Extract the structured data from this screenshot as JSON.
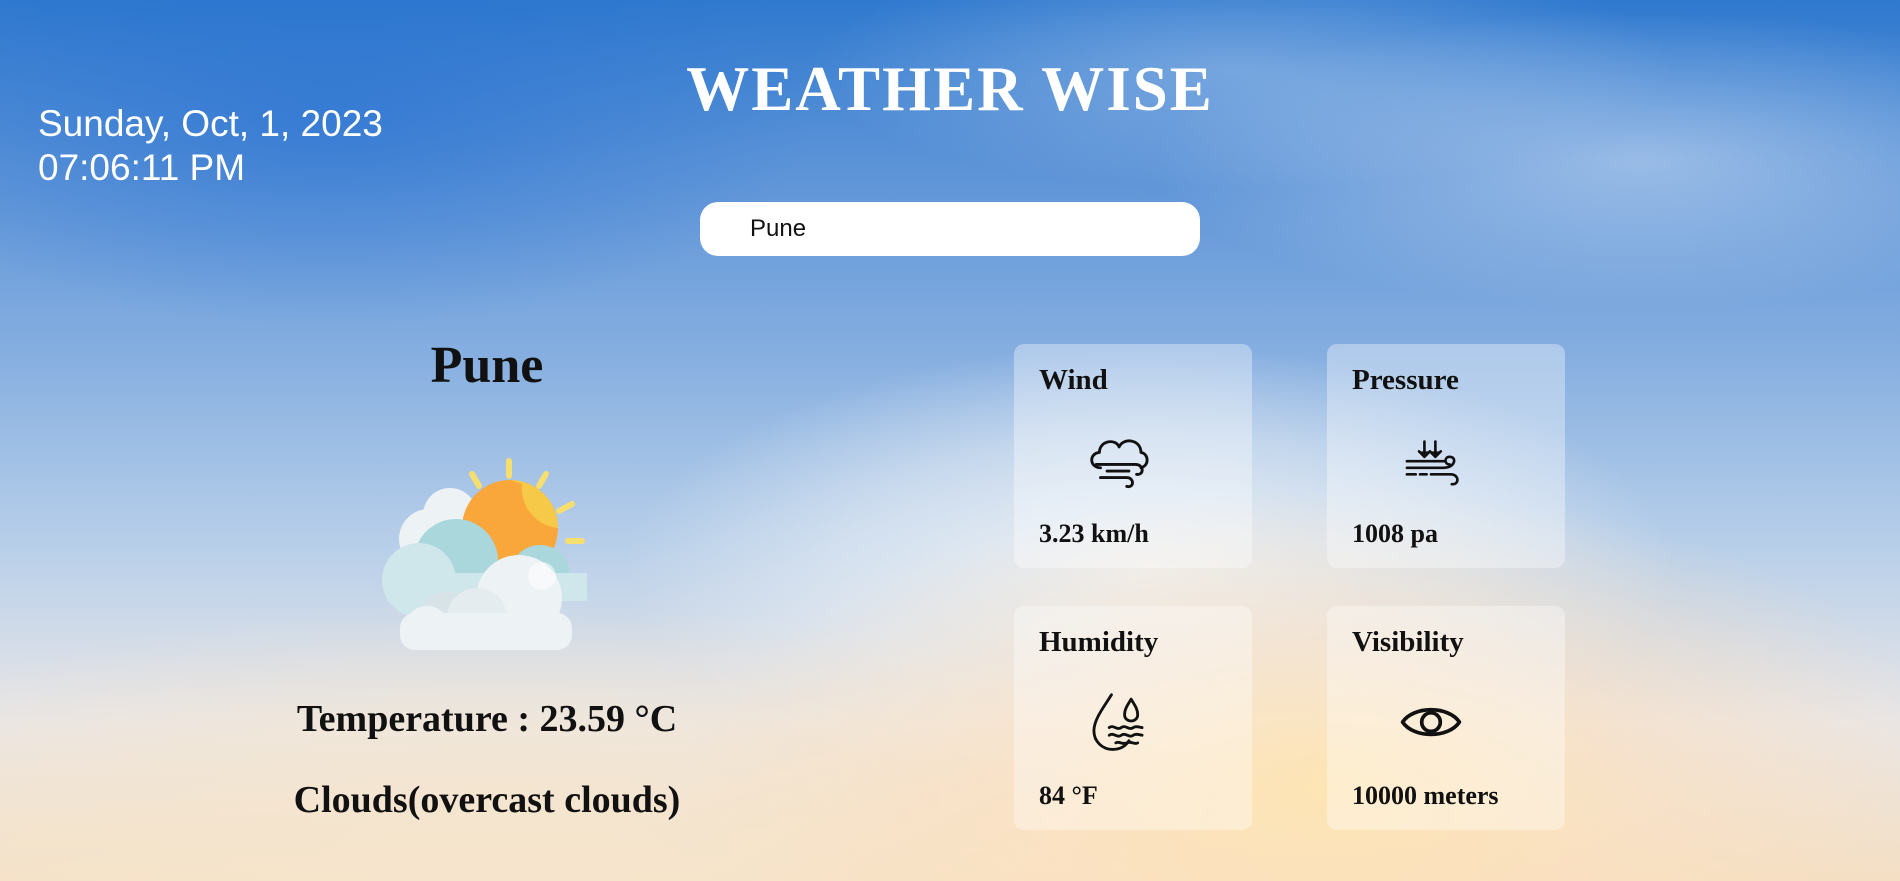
{
  "header": {
    "title": "WEATHER WISE",
    "date": "Sunday, Oct, 1, 2023",
    "time": "07:06:11 PM"
  },
  "search": {
    "value": "Pune",
    "placeholder": ""
  },
  "current": {
    "city": "Pune",
    "condition_icon": "partly-cloudy-sun-icon",
    "temperature_text": "Temperature : 23.59 °C",
    "description_text": "Clouds(overcast clouds)"
  },
  "metrics": {
    "wind": {
      "label": "Wind",
      "value": "3.23 km/h",
      "icon": "wind-cloud-icon"
    },
    "pressure": {
      "label": "Pressure",
      "value": "1008 pa",
      "icon": "pressure-icon"
    },
    "humidity": {
      "label": "Humidity",
      "value": "84 °F",
      "icon": "humidity-icon"
    },
    "visibility": {
      "label": "Visibility",
      "value": "10000 meters",
      "icon": "eye-icon"
    }
  },
  "colors": {
    "sky_top": "#2f79cf",
    "sky_horizon": "#f3dfc4",
    "sun": "#f9a63b",
    "text_dark": "#111111",
    "text_light": "#ffffff"
  }
}
